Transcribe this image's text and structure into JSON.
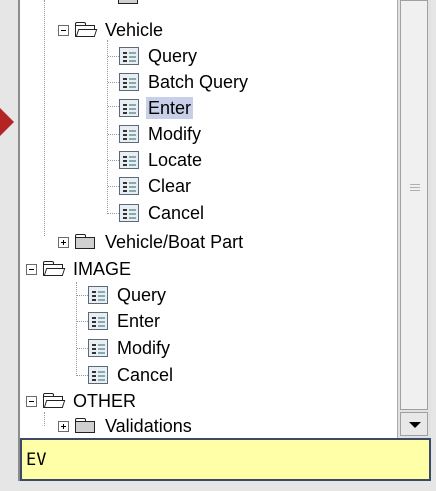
{
  "tree": {
    "vehicle": {
      "label": "Vehicle",
      "items": [
        "Query",
        "Batch Query",
        "Enter",
        "Modify",
        "Locate",
        "Clear",
        "Cancel"
      ],
      "selected": "Enter"
    },
    "vehicle_boat_part": {
      "label": "Vehicle/Boat Part"
    },
    "image": {
      "label": "IMAGE",
      "items": [
        "Query",
        "Enter",
        "Modify",
        "Cancel"
      ]
    },
    "other": {
      "label": "OTHER"
    },
    "validations": {
      "label": "Validations"
    }
  },
  "command_input": {
    "value": "EV"
  },
  "icons": {
    "expanded_toggle": "minus-box-icon",
    "collapsed_toggle": "plus-box-icon",
    "folder_open": "open-folder-icon",
    "folder_closed": "closed-folder-icon",
    "form": "form-document-icon",
    "pointer": "red-pointer-arrow"
  },
  "colors": {
    "selection": "#c8cfe8",
    "input_background": "#ffffa8",
    "pointer": "#b32424"
  }
}
